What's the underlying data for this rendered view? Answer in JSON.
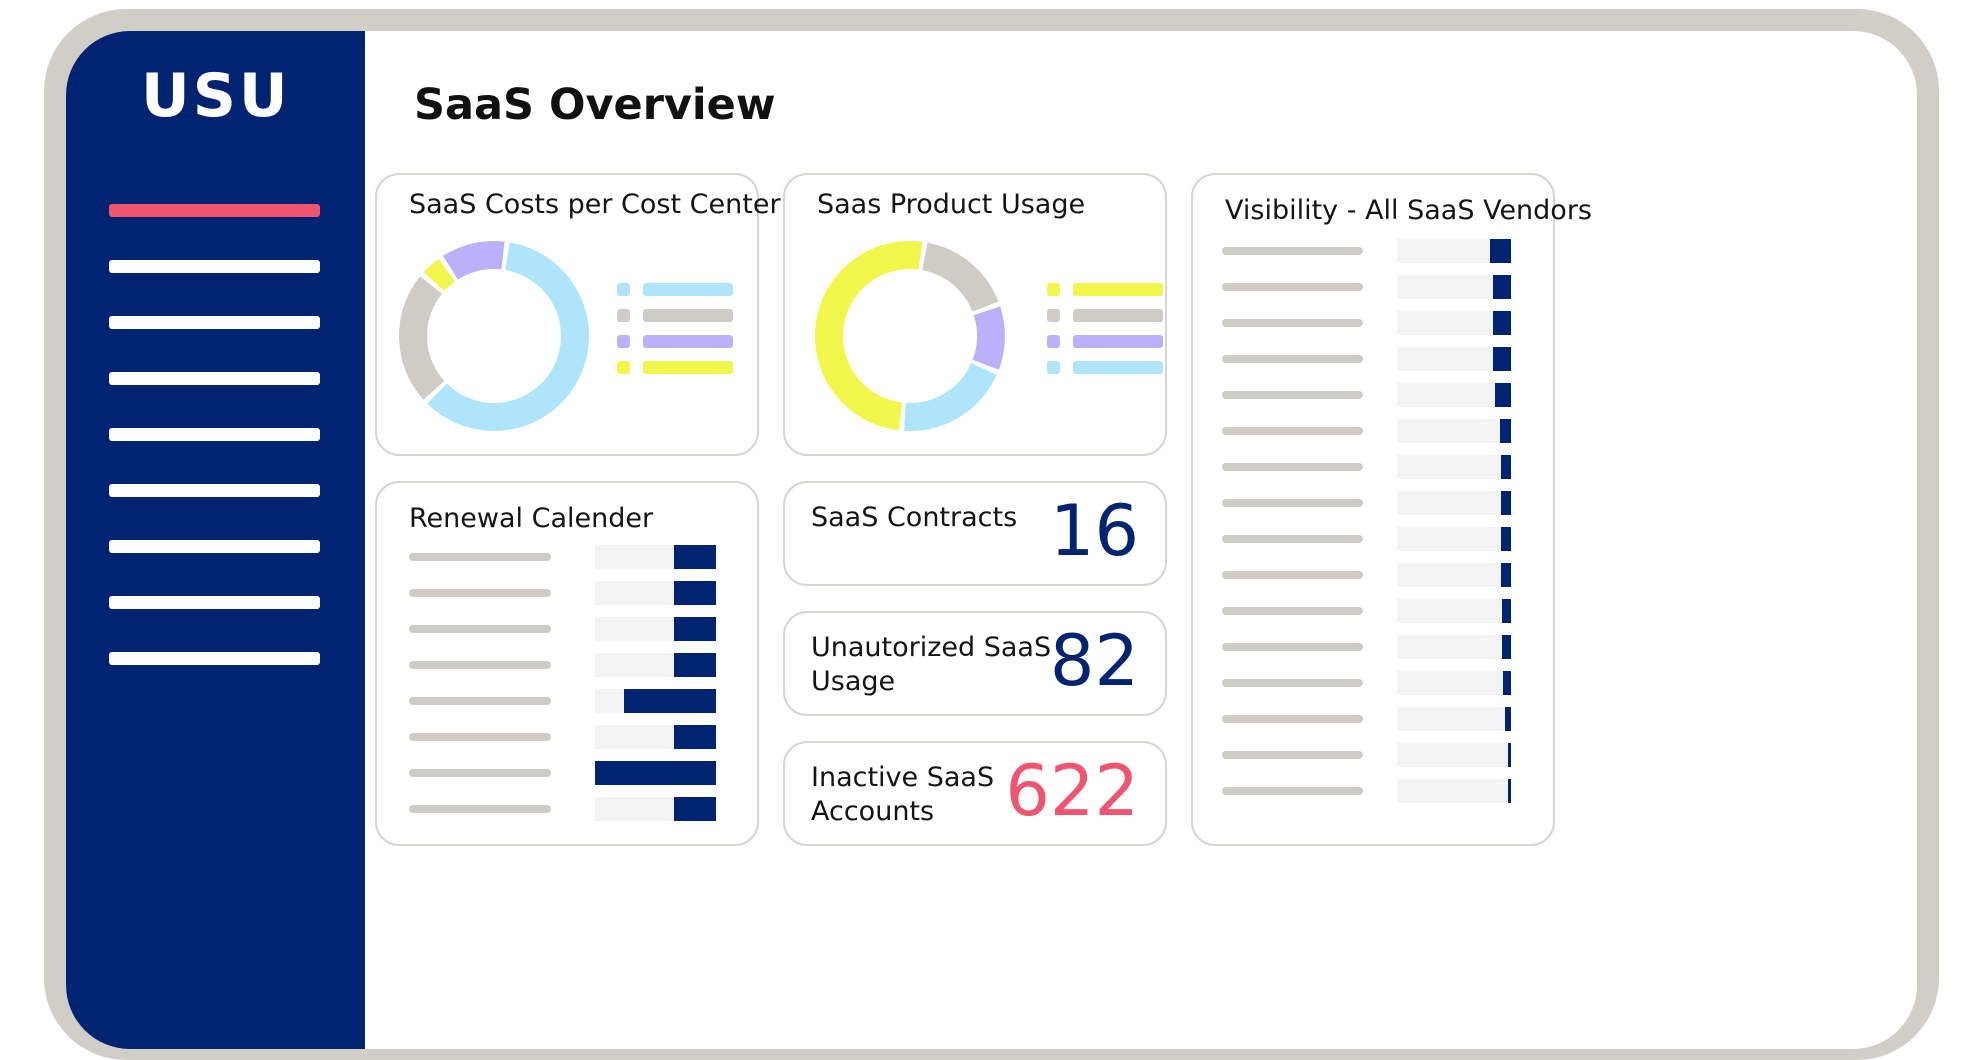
{
  "brand": {
    "logo_text": "USU"
  },
  "sidebar": {
    "items": [
      {
        "active": true
      },
      {
        "active": false
      },
      {
        "active": false
      },
      {
        "active": false
      },
      {
        "active": false
      },
      {
        "active": false
      },
      {
        "active": false
      },
      {
        "active": false
      },
      {
        "active": false
      }
    ]
  },
  "page": {
    "title": "SaaS Overview"
  },
  "colors": {
    "navy": "#012472",
    "accent_red": "#f0546e",
    "light_blue": "#aee5fb",
    "purple": "#bbb0fa",
    "yellow": "#f1f64b",
    "gray": "#cfccc6",
    "track": "#f3f3f3"
  },
  "cards": {
    "cost_center": {
      "title": "SaaS Costs per Cost Center",
      "legend": [
        "light-blue",
        "gray",
        "purple",
        "yellow"
      ]
    },
    "product_usage": {
      "title": "Saas Product Usage",
      "legend": [
        "yellow",
        "gray",
        "purple",
        "light-blue"
      ]
    },
    "renewal": {
      "title": "Renewal Calender",
      "row_fill_fractions": [
        0.35,
        0.35,
        0.35,
        0.35,
        0.76,
        0.35,
        1.0,
        0.35
      ]
    },
    "contracts": {
      "label": "SaaS Contracts",
      "value": "16"
    },
    "unauthorized": {
      "label": "Unautorized SaaS Usage",
      "value": "82"
    },
    "inactive": {
      "label": "Inactive SaaS Accounts",
      "value": "622"
    },
    "vendors": {
      "title": "Visibility - All SaaS Vendors",
      "row_fill_fractions": [
        0.18,
        0.16,
        0.16,
        0.16,
        0.14,
        0.1,
        0.09,
        0.09,
        0.09,
        0.09,
        0.08,
        0.08,
        0.07,
        0.05,
        0.03,
        0.03
      ]
    }
  },
  "chart_data": [
    {
      "type": "pie",
      "title": "SaaS Costs per Cost Center",
      "series": [
        {
          "color": "#aee5fb",
          "value": 57
        },
        {
          "color": "#cfccc6",
          "value": 22
        },
        {
          "color": "#f1f64b",
          "value": 4
        },
        {
          "color": "#bbb0fa",
          "value": 11
        }
      ]
    },
    {
      "type": "pie",
      "title": "Saas Product Usage",
      "series": [
        {
          "color": "#cfccc6",
          "value": 16
        },
        {
          "color": "#bbb0fa",
          "value": 11
        },
        {
          "color": "#aee5fb",
          "value": 19
        },
        {
          "color": "#f1f64b",
          "value": 48
        }
      ]
    }
  ]
}
